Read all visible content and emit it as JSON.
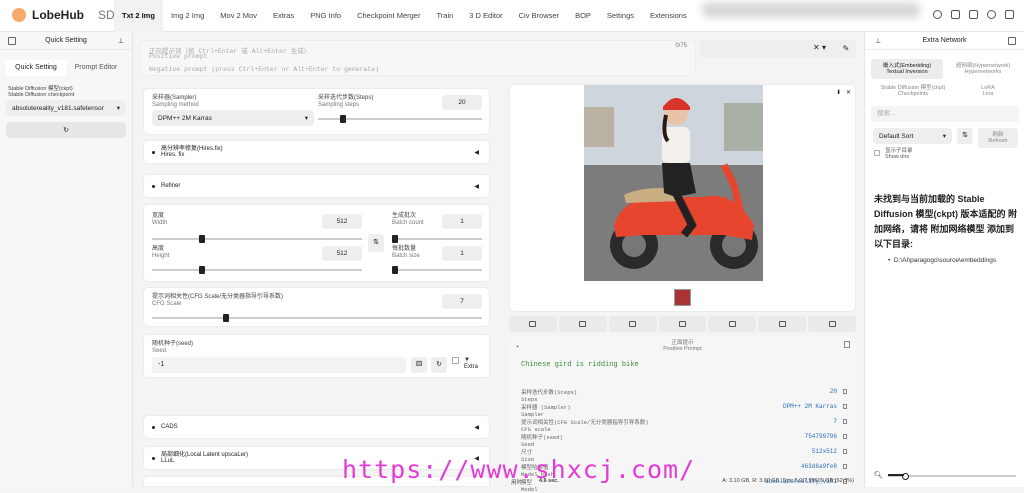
{
  "app": {
    "name": "LobeHub",
    "suffix": "SD"
  },
  "tabs": [
    "Txt 2 Img",
    "Img 2 Img",
    "Mov 2 Mov",
    "Extras",
    "PNG Info",
    "Checkpoint Merger",
    "Train",
    "3 D Editor",
    "Civ Browser",
    "BOP",
    "Settings",
    "Extensions"
  ],
  "active_tab": "Txt 2 Img",
  "quick_setting": {
    "title": "Quick Setting",
    "seg_quick": "Quick Setting",
    "seg_prompt": "Prompt Editor",
    "ckpt_label_cn": "Stable Diffusion 模型(ckpt)",
    "ckpt_label_en": "Stable Diffusion checkpoint",
    "ckpt_value": "absolutereality_v181.safetensor"
  },
  "prompt": {
    "placeholder_pos": "正向提示词（按 Ctrl+Enter 或 Alt+Enter 生成）",
    "placeholder_pos_en": "Positive prompt",
    "placeholder_neg": "Negative prompt (press Ctrl+Enter or Alt+Enter to generate)",
    "count": "0/75"
  },
  "sampler": {
    "label_cn": "采样器(Sampler)",
    "label_en": "Sampling method",
    "value": "DPM++ 2M Karras"
  },
  "steps": {
    "label_cn": "采样迭代步数(Steps)",
    "label_en": "Sampling steps",
    "value": "20",
    "fraction": 0.14
  },
  "hires": {
    "label_cn": "高分辨率修复(Hires.fix)",
    "label_en": "Hires. fix"
  },
  "refiner": {
    "label": "Refiner"
  },
  "width": {
    "label_cn": "宽度",
    "label_en": "Width",
    "value": "512",
    "fraction": 0.23
  },
  "height": {
    "label_cn": "高度",
    "label_en": "Height",
    "value": "512",
    "fraction": 0.23
  },
  "batch_count": {
    "label_cn": "生成批次",
    "label_en": "Batch count",
    "value": "1",
    "fraction": 0.0
  },
  "batch_size": {
    "label_cn": "每批数量",
    "label_en": "Batch size",
    "value": "1",
    "fraction": 0.0
  },
  "cfg": {
    "label_cn": "提示词相关性(CFG Scale/无分类器指导引导系数)",
    "label_en": "CFG Scale",
    "value": "7",
    "fraction": 0.22
  },
  "seed": {
    "label_cn": "随机种子(seed)",
    "label_en": "Seed",
    "value": "-1",
    "extra": "Extra"
  },
  "cads": {
    "label": "CADS"
  },
  "latent": {
    "label_cn": "局部细化(Local Latent upscaLer)",
    "label_en": "LLuL"
  },
  "output": {
    "positive_label_cn": "正面提示",
    "positive_label_en": "Positive Prompt",
    "prompt_text": "Chinese gird is ridding bike",
    "params": [
      {
        "k": "采样迭代步数(Steps)",
        "k2": "Steps",
        "v": "20"
      },
      {
        "k": "采样器 (Sampler)",
        "k2": "Sampler",
        "v": "DPM++ 2M Karras"
      },
      {
        "k": "提示词相关性(CFG Scale/无分类器指导引导系数)",
        "k2": "CFG scale",
        "v": "7"
      },
      {
        "k": "随机种子(seed)",
        "k2": "Seed",
        "v": "754799796"
      },
      {
        "k": "尺寸",
        "k2": "Size",
        "v": "512x512"
      },
      {
        "k": "模型哈希值",
        "k2": "Model hash",
        "v": "463d6a9fe8"
      },
      {
        "k": "模型",
        "k2": "Model",
        "v": "absolutereality_v181"
      }
    ],
    "time_label": "用时",
    "time_value": "4.6 sec.",
    "vram": "A: 3.10 GB, R: 3.60 GB, Sys: 5.0/7.99609 GB (62.3%)"
  },
  "extra_network": {
    "title": "Extra Network",
    "tab_embedding_cn": "嵌入式(Embedding)",
    "tab_embedding_en": "Textual Inversion",
    "tab_hyper_cn": "超网络(Hypernetwork)",
    "tab_hyper_en": "Hypernetworks",
    "tab_ckpt_cn": "Stable Diffusion 模型(ckpt)",
    "tab_ckpt_en": "Checkpoints",
    "tab_lora_cn": "LoRA",
    "tab_lora_en": "Lora",
    "search_placeholder": "搜索...",
    "sort_value": "Default Sort",
    "refresh_cn": "刷新",
    "refresh_en": "Refresh",
    "show_dirs_cn": "显示子目录",
    "show_dirs_en": "Show dirs",
    "message": "未找到与当前加载的 Stable Diffusion 模型(ckpt) 版本适配的 附加网络，请将 附加网络模型 添加到以下目录:",
    "path": "D:\\AI\\paragogo\\source\\embeddings"
  },
  "watermark": "https://www.shxcj.com/",
  "colors": {
    "accent": "#222222",
    "watermark": "#e23bd6",
    "param_value": "#2c6fb8",
    "prompt_text": "#3a8a3a"
  }
}
